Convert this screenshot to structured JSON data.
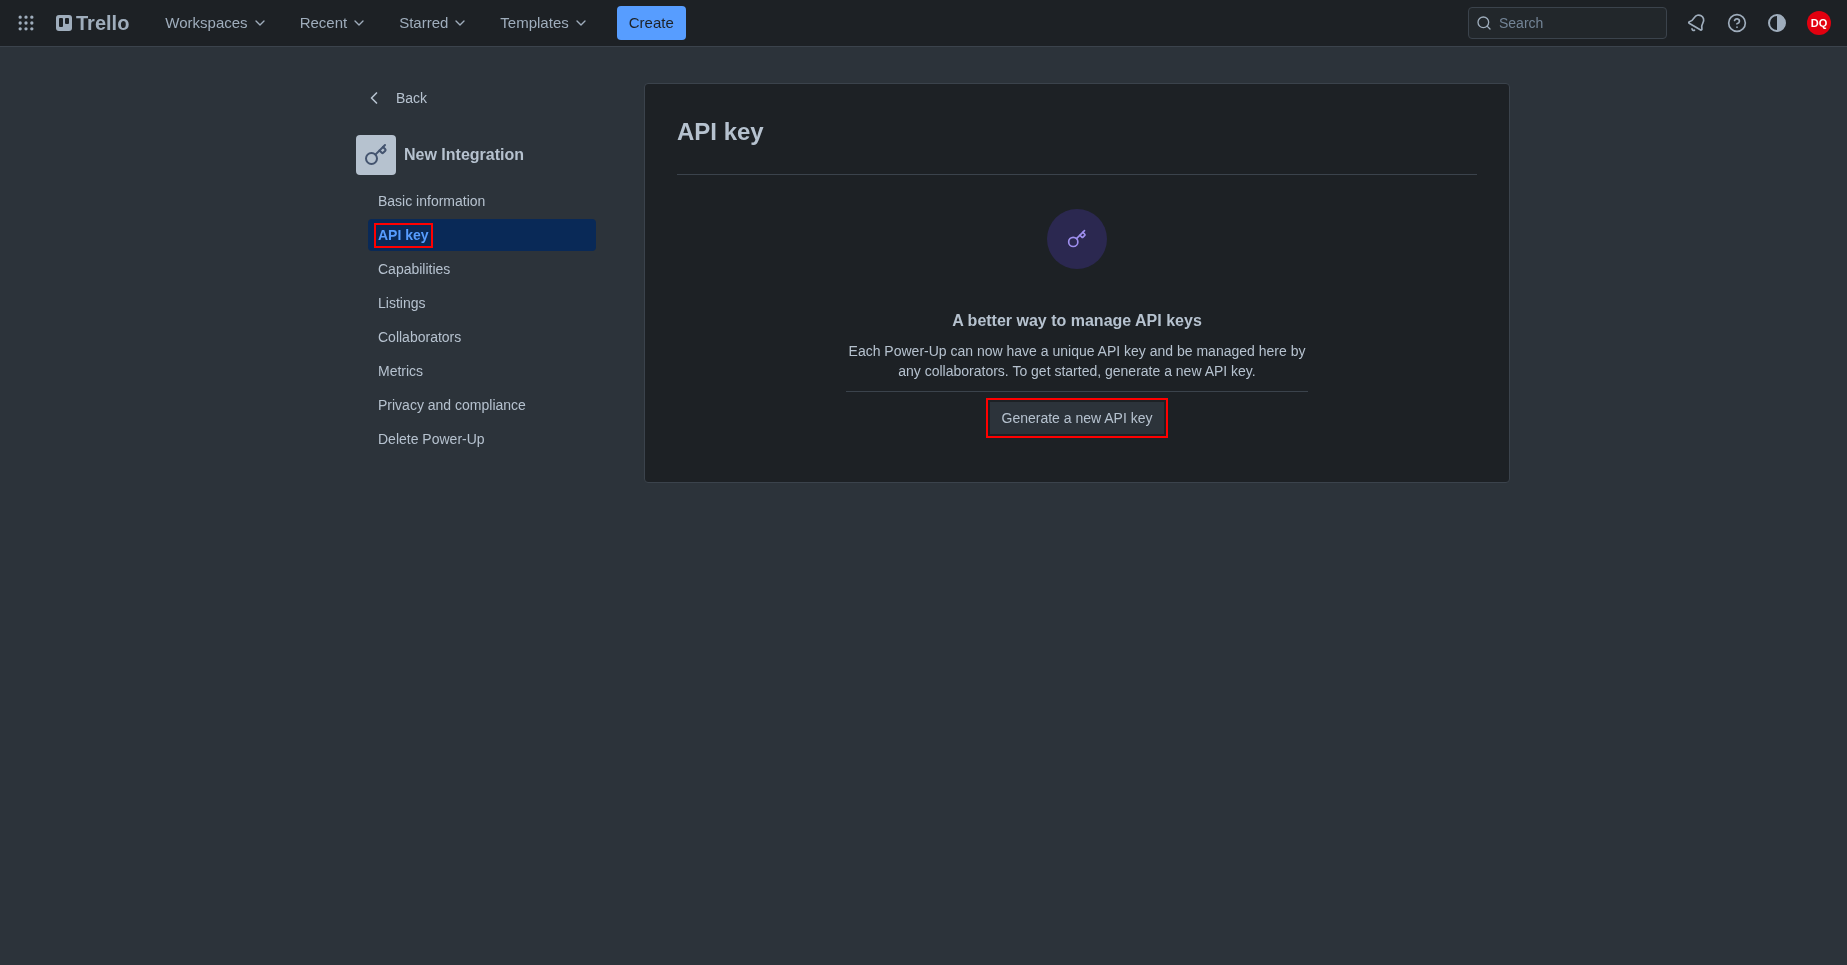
{
  "topbar": {
    "logo": "Trello",
    "menus": [
      {
        "label": "Workspaces"
      },
      {
        "label": "Recent"
      },
      {
        "label": "Starred"
      },
      {
        "label": "Templates"
      }
    ],
    "create": "Create",
    "search": {
      "placeholder": "Search"
    },
    "avatar": "DQ"
  },
  "sidebar": {
    "back": "Back",
    "title": "New Integration",
    "items": [
      {
        "label": "Basic information",
        "selected": false,
        "highlighted": false
      },
      {
        "label": "API key",
        "selected": true,
        "highlighted": true
      },
      {
        "label": "Capabilities",
        "selected": false,
        "highlighted": false
      },
      {
        "label": "Listings",
        "selected": false,
        "highlighted": false
      },
      {
        "label": "Collaborators",
        "selected": false,
        "highlighted": false
      },
      {
        "label": "Metrics",
        "selected": false,
        "highlighted": false
      },
      {
        "label": "Privacy and compliance",
        "selected": false,
        "highlighted": false
      },
      {
        "label": "Delete Power-Up",
        "selected": false,
        "highlighted": false
      }
    ]
  },
  "panel": {
    "title": "API key",
    "heading": "A better way to manage API keys",
    "description": "Each Power-Up can now have a unique API key and be managed here by any collaborators. To get started, generate a new API key.",
    "button": {
      "label": "Generate a new API key",
      "highlighted": true
    }
  }
}
